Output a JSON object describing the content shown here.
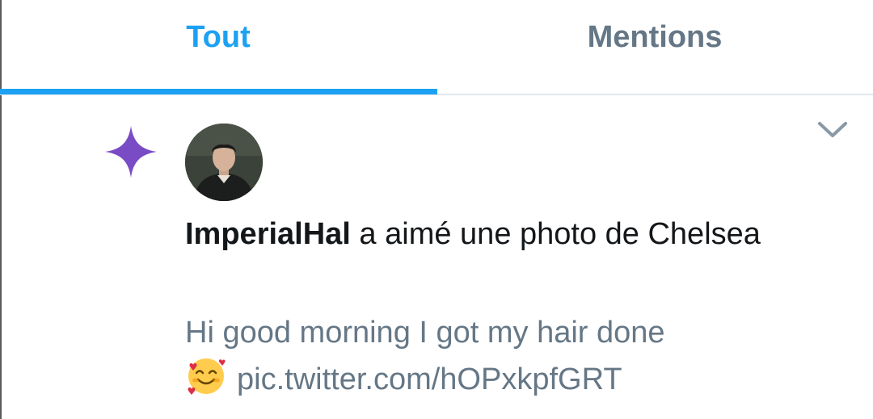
{
  "tabs": [
    {
      "label": "Tout",
      "active": true
    },
    {
      "label": "Mentions",
      "active": false
    }
  ],
  "colors": {
    "accent": "#1da1f2",
    "inactive_tab": "#657786",
    "sparkle": "#794bc4",
    "text": "#14171a",
    "secondary_text": "#657786"
  },
  "notification": {
    "icon": "sparkle-icon",
    "username": "ImperialHal",
    "action_text": " a aimé une photo de Chelsea",
    "tweet_text": "Hi good morning I got my hair done",
    "emoji": "smiling-face-with-hearts-emoji",
    "link_text": "pic.twitter.com/hOPxkpfGRT"
  }
}
